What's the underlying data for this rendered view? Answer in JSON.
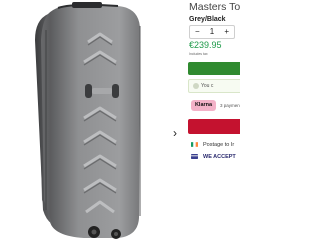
{
  "product": {
    "title": "Masters Tourer",
    "variant": "Grey/Black",
    "quantity": {
      "minus_label": "−",
      "value": "1",
      "plus_label": "+"
    },
    "price": "€239.95",
    "tax_note": "Includes tax"
  },
  "purchase": {
    "notice_text": "You c",
    "klarna_label": "Klarna",
    "payments_text": "3 paymen"
  },
  "shipping": {
    "postage_text": "Postage to Ir",
    "accept_text": "WE ACCEPT"
  },
  "gallery": {
    "next_label": "›"
  },
  "colors": {
    "price_green": "#1f9a4a",
    "add_button_green": "#2f8a2f",
    "buy_button_red": "#c4122f",
    "klarna_pink": "#f3b2c8",
    "case_grey": "#8a8b8d"
  },
  "icons": [
    "chevron-right-icon",
    "check-icon",
    "ireland-flag-icon",
    "card-icon"
  ]
}
